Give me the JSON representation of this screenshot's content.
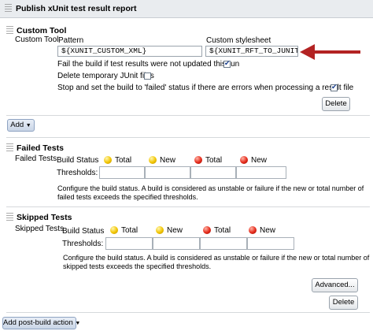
{
  "header": {
    "title": "Publish xUnit test result report"
  },
  "custom_tool": {
    "section_title": "Custom Tool",
    "row_label": "Custom Tool",
    "pattern_label": "Pattern",
    "pattern_value": "${XUNIT_CUSTOM_XML}",
    "stylesheet_label": "Custom stylesheet",
    "stylesheet_value": "${XUNIT_RFT_TO_JUNIT}",
    "options": [
      {
        "label": "Fail the build if test results were not updated this run",
        "checked": true
      },
      {
        "label": "Delete temporary JUnit files",
        "checked": false
      },
      {
        "label": "Stop and set the build to 'failed' status if there are errors when processing a result file",
        "checked": true
      }
    ],
    "delete_label": "Delete"
  },
  "add_button": {
    "label": "Add"
  },
  "failed_tests": {
    "section_title": "Failed Tests",
    "row_label": "Failed Tests",
    "build_status_label": "Build Status",
    "indicators": [
      {
        "color": "yellow",
        "label": "Total"
      },
      {
        "color": "yellow",
        "label": "New"
      },
      {
        "color": "red",
        "label": "Total"
      },
      {
        "color": "red",
        "label": "New"
      }
    ],
    "thresholds_label": "Thresholds:",
    "description": "Configure the build status. A build is considered as unstable or failure if the new or total number of failed tests exceeds the specified thresholds."
  },
  "skipped_tests": {
    "section_title": "Skipped Tests",
    "row_label": "Skipped Tests",
    "build_status_label": "Build Status",
    "indicators": [
      {
        "color": "yellow",
        "label": "Total"
      },
      {
        "color": "yellow",
        "label": "New"
      },
      {
        "color": "red",
        "label": "Total"
      },
      {
        "color": "red",
        "label": "New"
      }
    ],
    "thresholds_label": "Thresholds:",
    "description": "Configure the build status. A build is considered as unstable or failure if the new or total number of skipped tests exceeds the specified thresholds."
  },
  "footer": {
    "advanced_label": "Advanced...",
    "delete_label": "Delete",
    "add_post_build_label": "Add post-build action"
  },
  "colors": {
    "arrow": "#b32323",
    "header_bg": "#e9ecef"
  }
}
